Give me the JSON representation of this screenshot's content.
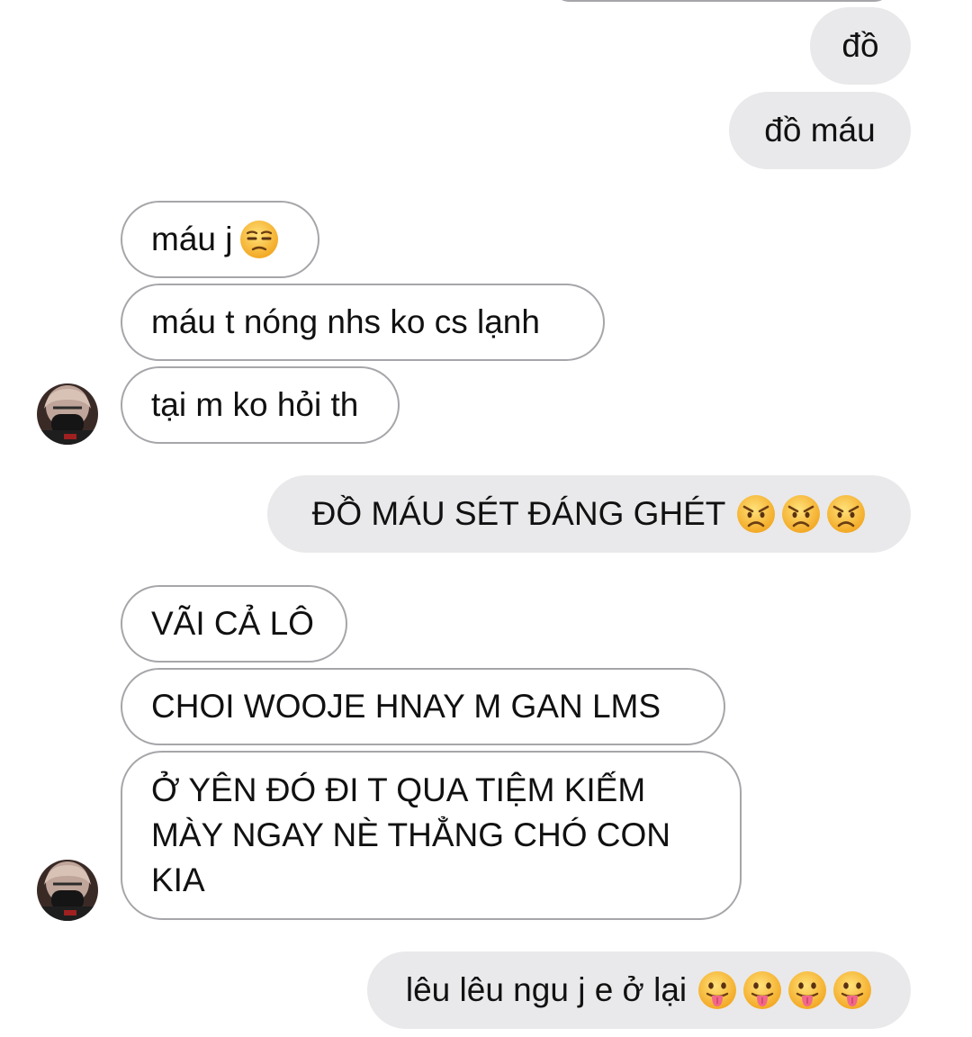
{
  "conversation": {
    "messages": [
      {
        "id": "m1",
        "side": "sent",
        "text": "đồ",
        "emojis": []
      },
      {
        "id": "m2",
        "side": "sent",
        "text": "đồ máu",
        "emojis": []
      },
      {
        "id": "m3",
        "side": "received",
        "text": "máu j",
        "emojis": [
          "unamused-face"
        ]
      },
      {
        "id": "m4",
        "side": "received",
        "text": "máu t nóng nhs ko cs lạnh",
        "emojis": []
      },
      {
        "id": "m5",
        "side": "received",
        "text": "tại m ko hỏi th",
        "emojis": []
      },
      {
        "id": "m6",
        "side": "sent",
        "text": "ĐỒ MÁU SÉT ĐÁNG GHÉT",
        "emojis": [
          "angry-face",
          "angry-face",
          "angry-face"
        ]
      },
      {
        "id": "m7",
        "side": "received",
        "text": "VÃI CẢ LÔ",
        "emojis": []
      },
      {
        "id": "m8",
        "side": "received",
        "text": "CHOI WOOJE HNAY M GAN LMS",
        "emojis": []
      },
      {
        "id": "m9",
        "side": "received",
        "text": "Ở YÊN ĐÓ ĐI T QUA TIỆM KIẾM MÀY NGAY NÈ THẲNG CHÓ CON KIA",
        "emojis": []
      },
      {
        "id": "m10",
        "side": "sent",
        "text": "lêu lêu ngu j e ở lại",
        "emojis": [
          "face-with-tongue",
          "face-with-tongue",
          "face-with-tongue",
          "face-with-tongue"
        ]
      }
    ]
  },
  "colors": {
    "sent_bubble": "#e9e9eb",
    "received_border": "#a6a6aa",
    "text": "#111111",
    "emoji_yellow": "#f7b52c"
  },
  "icons": {
    "avatar": "contact-avatar-masked-person"
  }
}
